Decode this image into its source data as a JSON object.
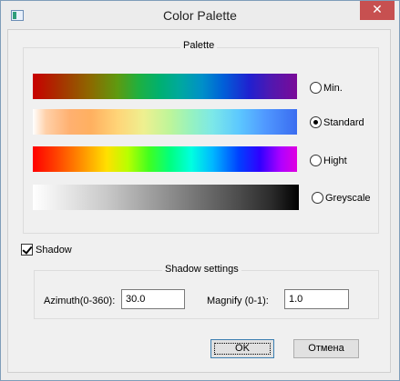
{
  "window": {
    "title": "Color Palette",
    "close_glyph": "✕"
  },
  "palette": {
    "group_title": "Palette",
    "options": [
      {
        "label": "Min.",
        "checked": false
      },
      {
        "label": "Standard",
        "checked": true
      },
      {
        "label": "Hight",
        "checked": false
      },
      {
        "label": "Greyscale",
        "checked": false
      }
    ]
  },
  "shadow": {
    "checkbox_label": "Shadow",
    "checked": true,
    "group_title": "Shadow settings",
    "azimuth_label": "Azimuth(0-360):",
    "azimuth_value": "30.0",
    "magnify_label": "Magnify (0-1):",
    "magnify_value": "1.0"
  },
  "buttons": {
    "ok_label": "OK",
    "cancel_label": "Отмена"
  },
  "colors": {
    "close_button": "#c75050",
    "dialog_background": "#f0f0f0"
  }
}
